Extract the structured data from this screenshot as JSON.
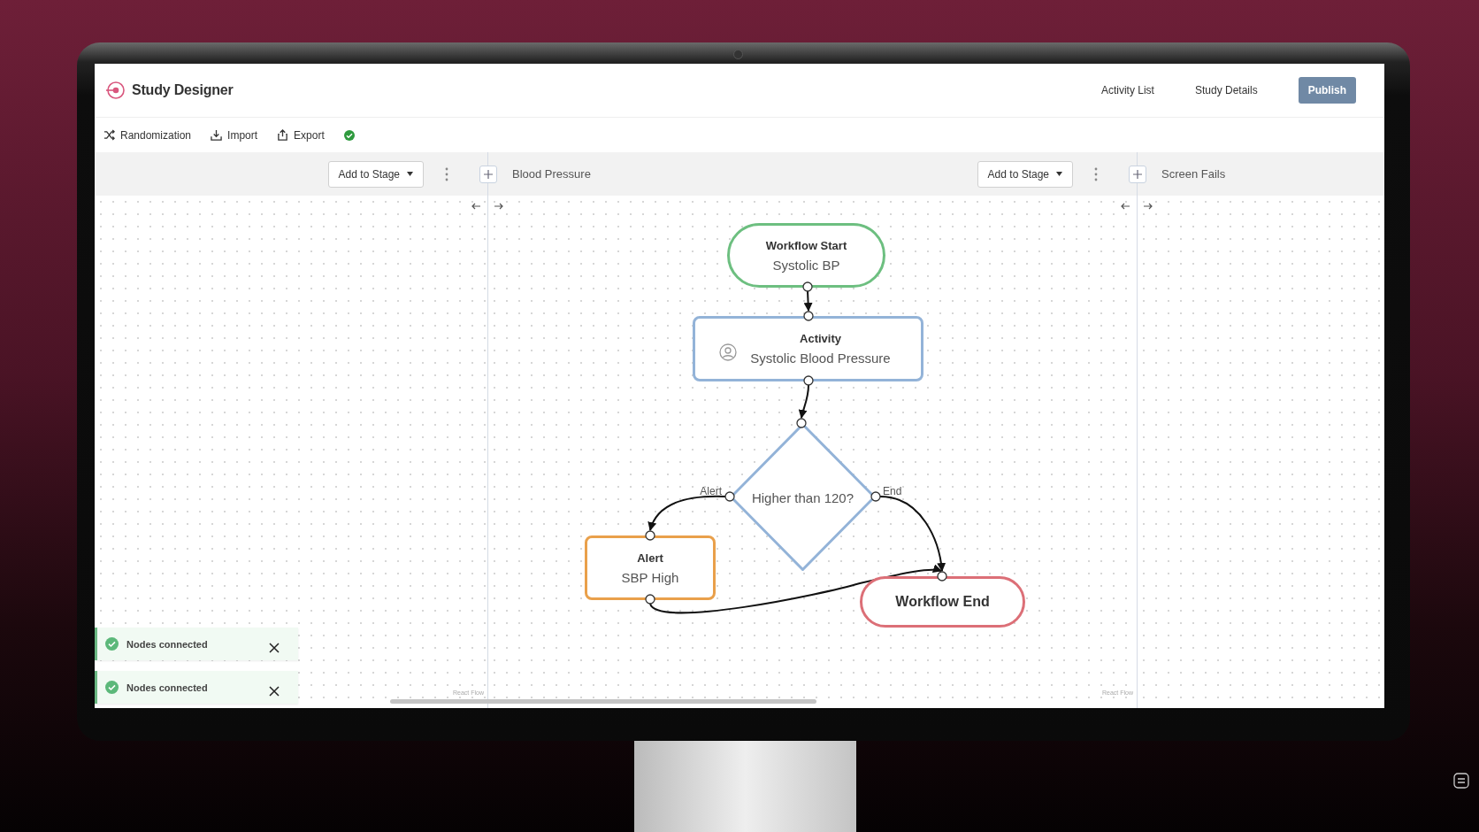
{
  "header": {
    "title": "Study Designer",
    "nav": [
      "Activity List",
      "Study Details"
    ],
    "publish": "Publish"
  },
  "toolbar": {
    "items": [
      {
        "kind": "randomize",
        "label": "Randomization"
      },
      {
        "kind": "import",
        "label": "Import"
      },
      {
        "kind": "export",
        "label": "Export"
      }
    ],
    "status_ok": true
  },
  "stages": [
    {
      "add_button": "Add to Stage",
      "attribution": "React Flow"
    },
    {
      "name": "Blood Pressure",
      "add_button": "Add to Stage",
      "attribution": "React Flow"
    },
    {
      "name": "Screen Fails"
    }
  ],
  "flow": {
    "nodes": [
      {
        "kind": "start",
        "title": "Workflow Start",
        "subtitle": "Systolic BP",
        "color": "#6dbf80"
      },
      {
        "kind": "activity",
        "title": "Activity",
        "subtitle": "Systolic Blood Pressure",
        "color": "#93b3d8"
      },
      {
        "kind": "decision",
        "title": "Higher than 120?",
        "branches": [
          "Alert",
          "End"
        ],
        "color": "#93b3d8"
      },
      {
        "kind": "alert",
        "title": "Alert",
        "subtitle": "SBP High",
        "color": "#e9a04b"
      },
      {
        "kind": "end",
        "title": "Workflow End",
        "color": "#dc6f77"
      }
    ]
  },
  "toasts": [
    {
      "message": "Nodes connected"
    },
    {
      "message": "Nodes connected"
    }
  ]
}
